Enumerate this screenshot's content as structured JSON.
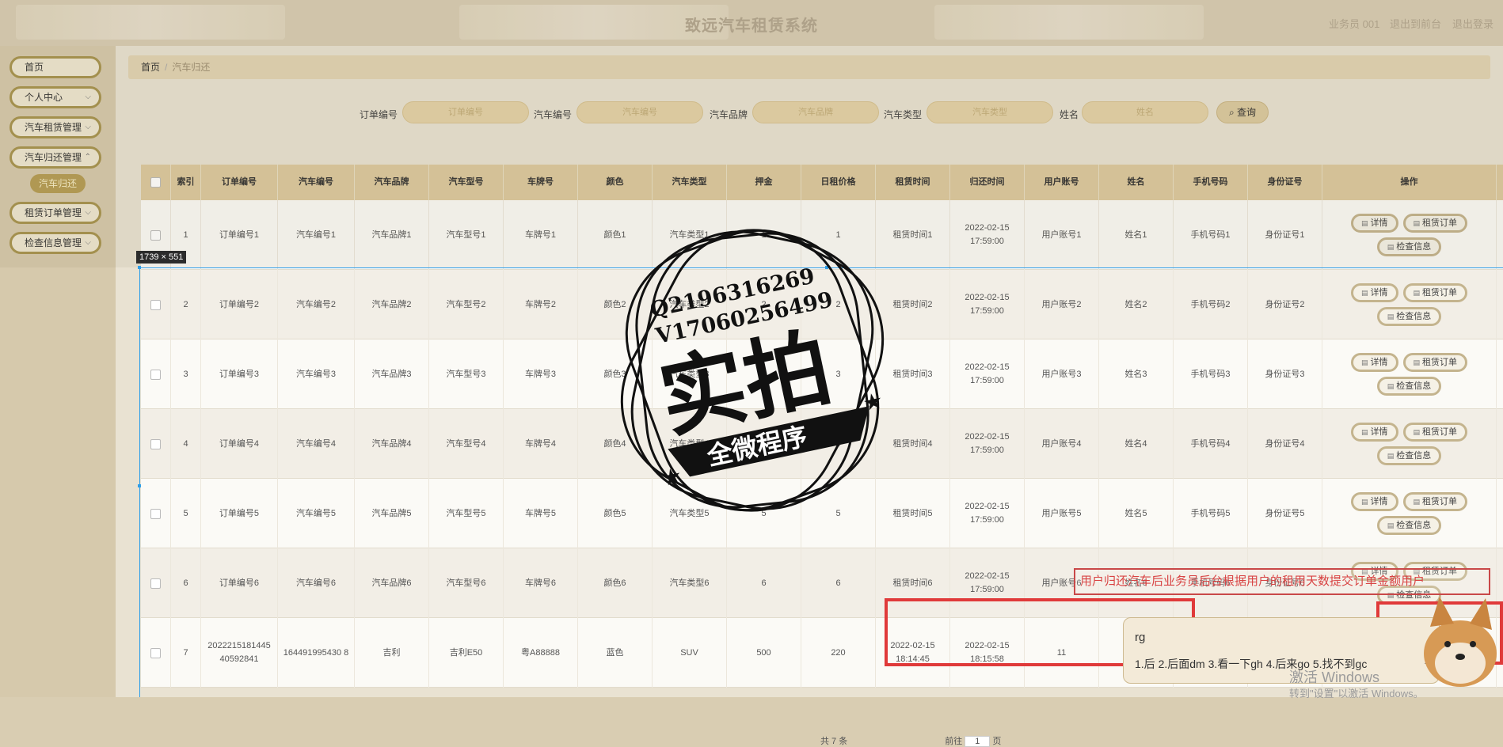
{
  "header": {
    "title": "致远汽车租赁系统",
    "user_label": "业务员 001",
    "back_label": "退出到前台",
    "logout_label": "退出登录"
  },
  "sidebar": {
    "items": [
      {
        "label": "首页",
        "has_arrow": false
      },
      {
        "label": "个人中心",
        "has_arrow": true
      },
      {
        "label": "汽车租赁管理",
        "has_arrow": true
      },
      {
        "label": "汽车归还管理",
        "has_arrow": true
      },
      {
        "label": "租赁订单管理",
        "has_arrow": true
      },
      {
        "label": "检查信息管理",
        "has_arrow": true
      }
    ],
    "active_sub": "汽车归还"
  },
  "breadcrumb": {
    "home": "首页",
    "sep": "/",
    "current": "汽车归还"
  },
  "search": {
    "fields": [
      {
        "label": "订单编号",
        "placeholder": "订单编号"
      },
      {
        "label": "汽车编号",
        "placeholder": "汽车编号"
      },
      {
        "label": "汽车品牌",
        "placeholder": "汽车品牌"
      },
      {
        "label": "汽车类型",
        "placeholder": "汽车类型"
      },
      {
        "label": "姓名",
        "placeholder": "姓名"
      }
    ],
    "button": "查询"
  },
  "table": {
    "columns": [
      "",
      "索引",
      "订单编号",
      "汽车编号",
      "汽车品牌",
      "汽车型号",
      "车牌号",
      "颜色",
      "汽车类型",
      "押金",
      "日租价格",
      "租赁时间",
      "归还时间",
      "用户账号",
      "姓名",
      "手机号码",
      "身份证号",
      "操作"
    ],
    "rows": [
      [
        "",
        "1",
        "订单编号1",
        "汽车编号1",
        "汽车品牌1",
        "汽车型号1",
        "车牌号1",
        "颜色1",
        "汽车类型1",
        "1",
        "1",
        "租赁时间1",
        "2022-02-15 17:59:00",
        "用户账号1",
        "姓名1",
        "手机号码1",
        "身份证号1"
      ],
      [
        "",
        "2",
        "订单编号2",
        "汽车编号2",
        "汽车品牌2",
        "汽车型号2",
        "车牌号2",
        "颜色2",
        "汽车类型2",
        "2",
        "2",
        "租赁时间2",
        "2022-02-15 17:59:00",
        "用户账号2",
        "姓名2",
        "手机号码2",
        "身份证号2"
      ],
      [
        "",
        "3",
        "订单编号3",
        "汽车编号3",
        "汽车品牌3",
        "汽车型号3",
        "车牌号3",
        "颜色3",
        "汽车类型3",
        "3",
        "3",
        "租赁时间3",
        "2022-02-15 17:59:00",
        "用户账号3",
        "姓名3",
        "手机号码3",
        "身份证号3"
      ],
      [
        "",
        "4",
        "订单编号4",
        "汽车编号4",
        "汽车品牌4",
        "汽车型号4",
        "车牌号4",
        "颜色4",
        "汽车类型4",
        "4",
        "4",
        "租赁时间4",
        "2022-02-15 17:59:00",
        "用户账号4",
        "姓名4",
        "手机号码4",
        "身份证号4"
      ],
      [
        "",
        "5",
        "订单编号5",
        "汽车编号5",
        "汽车品牌5",
        "汽车型号5",
        "车牌号5",
        "颜色5",
        "汽车类型5",
        "5",
        "5",
        "租赁时间5",
        "2022-02-15 17:59:00",
        "用户账号5",
        "姓名5",
        "手机号码5",
        "身份证号5"
      ],
      [
        "",
        "6",
        "订单编号6",
        "汽车编号6",
        "汽车品牌6",
        "汽车型号6",
        "车牌号6",
        "颜色6",
        "汽车类型6",
        "6",
        "6",
        "租赁时间6",
        "2022-02-15 17:59:00",
        "用户账号6",
        "姓名6",
        "手机号码6",
        "身份证号6"
      ],
      [
        "",
        "7",
        "2022215181445 40592841",
        "164491995430 8",
        "吉利",
        "吉利E50",
        "粤A88888",
        "蓝色",
        "SUV",
        "500",
        "220",
        "2022-02-15 18:14:45",
        "2022-02-15 18:15:58",
        "11",
        "",
        "",
        ""
      ]
    ],
    "actions": {
      "detail": "详情",
      "order": "租赁订单",
      "check": "检查信息"
    }
  },
  "pager": {
    "total": "共 7 条",
    "goto": "前往",
    "page": "1",
    "page_unit": "页"
  },
  "overlay": {
    "selection_size": "1739 × 551",
    "annotation": "用户归还汽车后业务员后台根据用户的租用天数提交订单金额用户"
  },
  "watermark": {
    "line1": "Q2196316269",
    "line2": "V17060256499",
    "big": "实拍",
    "ribbon": "全微程序"
  },
  "ime": {
    "composition": "rg",
    "candidates": "1.后  2.后面dm  3.看一下gh  4.后来go  5.找不到gc",
    "more": "›"
  },
  "os": {
    "activate_title": "激活 Windows",
    "activate_sub": "转到\"设置\"以激活 Windows。"
  }
}
